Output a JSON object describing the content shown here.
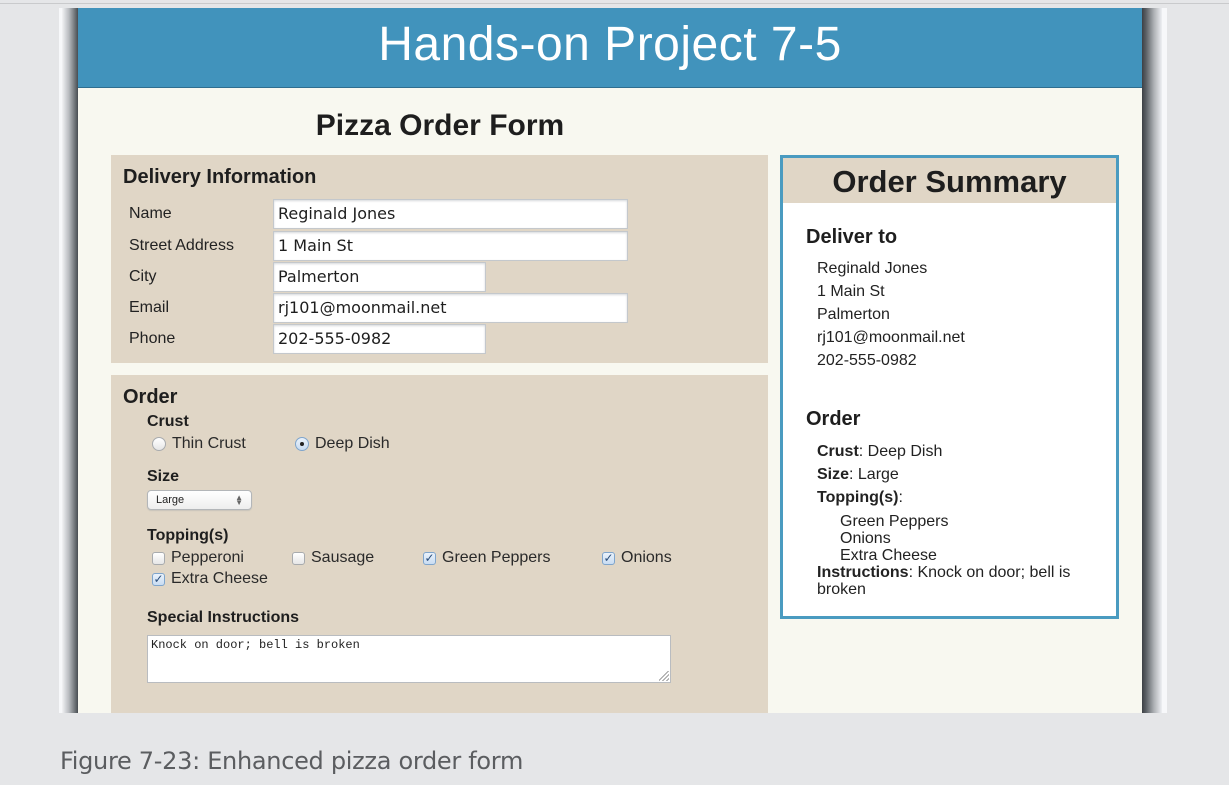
{
  "page": {
    "header_title": "Hands-on Project 7-5",
    "form_title": "Pizza Order Form"
  },
  "delivery": {
    "legend": "Delivery Information",
    "fields": [
      {
        "label": "Name",
        "value": "Reginald Jones"
      },
      {
        "label": "Street Address",
        "value": "1 Main St"
      },
      {
        "label": "City",
        "value": "Palmerton"
      },
      {
        "label": "Email",
        "value": "rj101@moonmail.net"
      },
      {
        "label": "Phone",
        "value": "202-555-0982"
      }
    ]
  },
  "order": {
    "legend": "Order",
    "crust": {
      "label": "Crust",
      "options": [
        {
          "label": "Thin Crust",
          "selected": false
        },
        {
          "label": "Deep Dish",
          "selected": true
        }
      ]
    },
    "size": {
      "label": "Size",
      "selected": "Large"
    },
    "toppings": {
      "label": "Topping(s)",
      "options": [
        {
          "label": "Pepperoni",
          "checked": false
        },
        {
          "label": "Sausage",
          "checked": false
        },
        {
          "label": "Green Peppers",
          "checked": true
        },
        {
          "label": "Onions",
          "checked": true
        },
        {
          "label": "Extra Cheese",
          "checked": true
        }
      ]
    },
    "instructions": {
      "label": "Special Instructions",
      "value": "Knock on door; bell is broken"
    }
  },
  "summary": {
    "title": "Order Summary",
    "deliver_to": {
      "heading": "Deliver to",
      "lines": [
        "Reginald Jones",
        "1 Main St",
        "Palmerton",
        "rj101@moonmail.net",
        "202-555-0982"
      ]
    },
    "order": {
      "heading": "Order",
      "crust_label": "Crust",
      "crust_value": ": Deep Dish",
      "size_label": "Size",
      "size_value": ": Large",
      "toppings_label": "Topping(s)",
      "toppings_suffix": ":",
      "toppings": [
        "Green Peppers",
        "Onions",
        "Extra Cheese"
      ],
      "instructions_label": "Instructions",
      "instructions_value": ": Knock on door; bell is",
      "instructions_value_wrap": "broken"
    }
  },
  "caption": "Figure 7-23: Enhanced pizza order form"
}
